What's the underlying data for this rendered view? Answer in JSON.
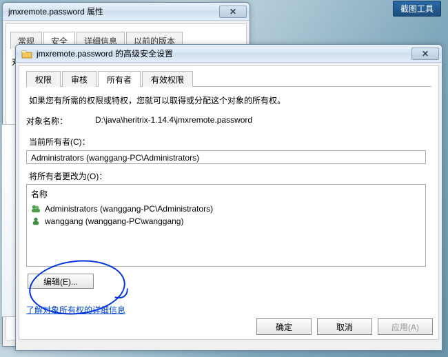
{
  "crop_tool_label": "截图工具",
  "win1": {
    "title": "jmxremote.password 属性",
    "tabs": {
      "general": "常规",
      "security": "安全",
      "details": "详细信息",
      "previous": "以前的版本"
    },
    "object_label": "对象名称："
  },
  "win2": {
    "title": "jmxremote.password 的高级安全设置",
    "tabs": {
      "perm": "权限",
      "audit": "审核",
      "owner": "所有者",
      "effective": "有效权限"
    },
    "intro": "如果您有所需的权限或特权，您就可以取得或分配这个对象的所有权。",
    "obj_label": "对象名称：",
    "obj_value": "D:\\java\\heritrix-1.14.4\\jmxremote.password",
    "cur_owner_label": "当前所有者(C)：",
    "cur_owner_value": "Administrators (wanggang-PC\\Administrators)",
    "change_label": "将所有者更改为(O)：",
    "name_header": "名称",
    "owners": [
      "Administrators (wanggang-PC\\Administrators)",
      "wanggang (wanggang-PC\\wanggang)"
    ],
    "edit_btn": "编辑(E)...",
    "learn_link": "了解对象所有权的详细信息",
    "ok": "确定",
    "cancel": "取消",
    "apply": "应用(A)"
  }
}
